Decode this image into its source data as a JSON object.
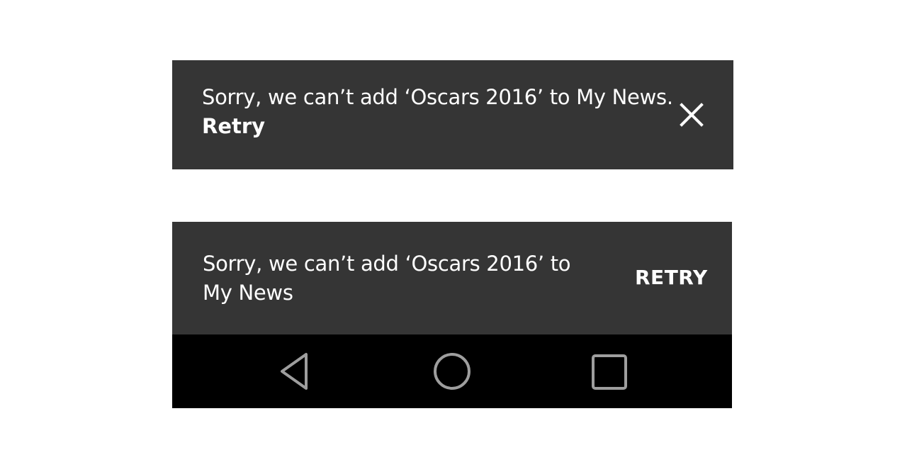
{
  "ios_snackbar": {
    "message": "Sorry, we can’t add ‘Oscars 2016’ to My News.",
    "action_label": "Retry",
    "close_icon": "close-icon"
  },
  "android_snackbar": {
    "message_line1": "Sorry, we can’t add ‘Oscars 2016’ to",
    "message_line2": "My News",
    "action_label": "RETRY"
  },
  "navigation_bar": {
    "buttons": [
      {
        "icon": "back-triangle-icon"
      },
      {
        "icon": "home-circle-icon"
      },
      {
        "icon": "recents-square-icon"
      }
    ]
  },
  "colors": {
    "snackbar_bg": "#353535",
    "navbar_bg": "#000000",
    "nav_icon": "#9e9e9e",
    "text": "#ffffff"
  }
}
